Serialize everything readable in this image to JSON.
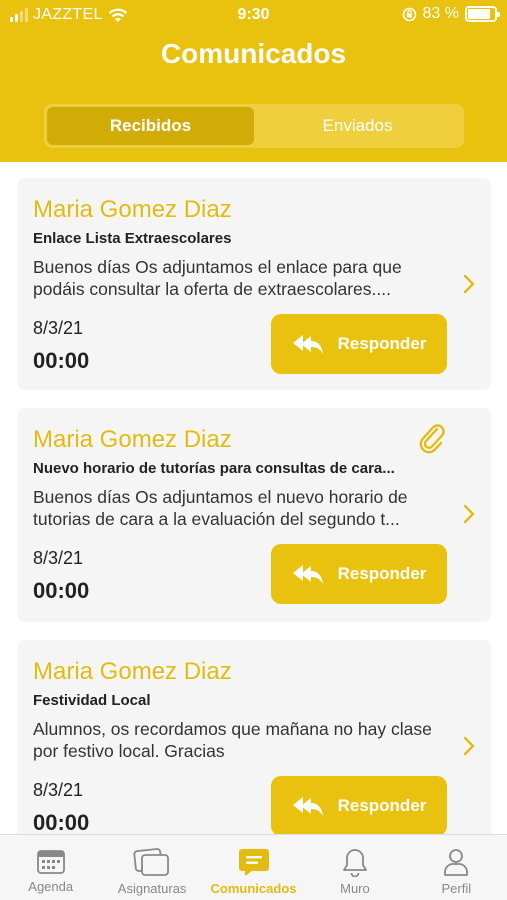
{
  "status": {
    "carrier": "JAZZTEL",
    "time": "9:30",
    "battery": "83 %",
    "battery_level": 0.83
  },
  "header": {
    "title": "Comunicados"
  },
  "segments": [
    {
      "label": "Recibidos",
      "active": true
    },
    {
      "label": "Enviados",
      "active": false
    }
  ],
  "messages": [
    {
      "sender": "Maria Gomez Diaz",
      "subject": "Enlace Lista Extraescolares",
      "body": "Buenos días Os adjuntamos el enlace para que podáis consultar la oferta de extraescolares....",
      "date": "8/3/21",
      "time": "00:00",
      "attachment": false,
      "reply_label": "Responder"
    },
    {
      "sender": "Maria Gomez Diaz",
      "subject": "Nuevo horario de tutorías para consultas de cara...",
      "body": "Buenos días Os adjuntamos el nuevo horario de tutorias de cara a la evaluación del segundo t...",
      "date": "8/3/21",
      "time": "00:00",
      "attachment": true,
      "reply_label": "Responder"
    },
    {
      "sender": "Maria Gomez Diaz",
      "subject": "Festividad Local",
      "body": "Alumnos, os recordamos que mañana no hay clase por festivo local. Gracias",
      "date": "8/3/21",
      "time": "00:00",
      "attachment": false,
      "reply_label": "Responder"
    }
  ],
  "tabs": [
    {
      "label": "Agenda",
      "icon": "calendar-icon",
      "active": false
    },
    {
      "label": "Asignaturas",
      "icon": "cards-icon",
      "active": false
    },
    {
      "label": "Comunicados",
      "icon": "chat-bubble-icon",
      "active": true
    },
    {
      "label": "Muro",
      "icon": "bell-icon",
      "active": false
    },
    {
      "label": "Perfil",
      "icon": "person-icon",
      "active": false
    }
  ],
  "colors": {
    "brand": "#E8C20E",
    "brand_dark": "#D1AC07",
    "card_bg": "#F5F5F5"
  }
}
